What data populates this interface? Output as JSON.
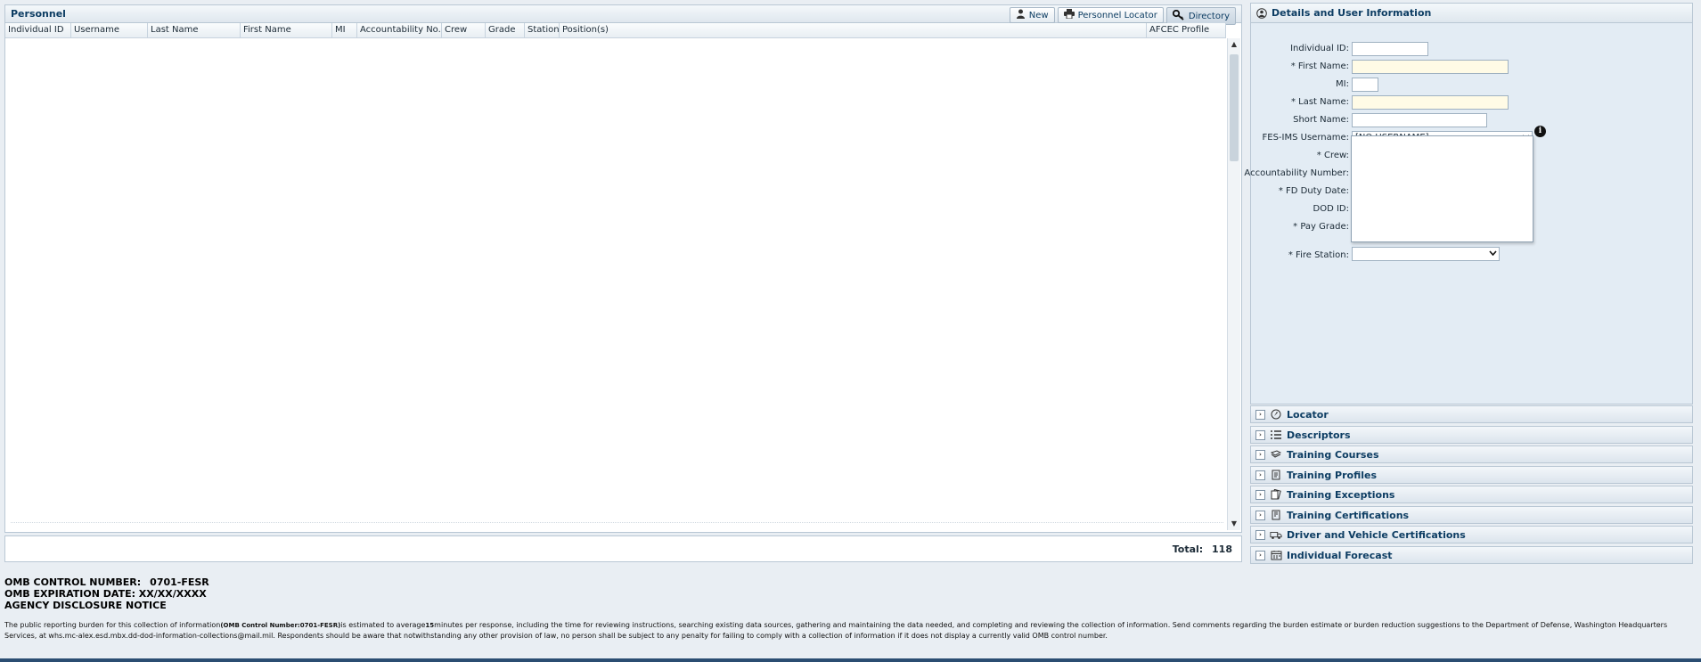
{
  "personnel": {
    "title": "Personnel",
    "buttons": {
      "new": "New",
      "locator": "Personnel Locator",
      "directory": "Directory"
    },
    "columns": [
      "Individual ID",
      "Username",
      "Last Name",
      "First Name",
      "MI",
      "Accountability No.",
      "Crew",
      "Grade",
      "Station",
      "Position(s)",
      "AFCEC Profile"
    ],
    "total_label": "Total:",
    "total_value": "118"
  },
  "details": {
    "title": "Details and User Information",
    "fields": {
      "individual_id": "Individual ID:",
      "first_name": "* First Name:",
      "mi": "MI:",
      "last_name": "* Last Name:",
      "short_name": "Short Name:",
      "username": "FES-IMS Username:",
      "crew": "* Crew:",
      "accountability": "Accountability Number:",
      "fd_duty": "* FD Duty Date:",
      "dod_id": "DOD ID:",
      "pay_grade": "* Pay Grade:",
      "fire_station": "* Fire Station:"
    },
    "username_value": "[NO USERNAME]"
  },
  "sections": [
    "Locator",
    "Descriptors",
    "Training Courses",
    "Training Profiles",
    "Training Exceptions",
    "Training Certifications",
    "Driver and Vehicle Certifications",
    "Individual Forecast"
  ],
  "omb": {
    "control_label": "OMB CONTROL NUMBER:",
    "control_value": "0701-FESR",
    "expiration": "OMB EXPIRATION DATE: XX/XX/XXXX",
    "agency": "AGENCY DISCLOSURE NOTICE",
    "notice_a": "The public reporting burden for this collection of information",
    "notice_b": "(OMB Control Number:0701-FESR)",
    "notice_c": "is estimated to average",
    "notice_d": "15",
    "notice_e": "minutes per response, including the time for reviewing instructions, searching existing data sources, gathering and maintaining the data needed, and completing and reviewing the collection of information. Send comments regarding the burden estimate or burden reduction suggestions to the Department of Defense, Washington Headquarters Services, at whs.mc-alex.esd.mbx.dd-dod-information-collections@mail.mil. Respondents should be aware that notwithstanding any other provision of law, no person shall be subject to any penalty for failing to comply with a collection of information if it does not display a currently valid OMB control number."
  }
}
